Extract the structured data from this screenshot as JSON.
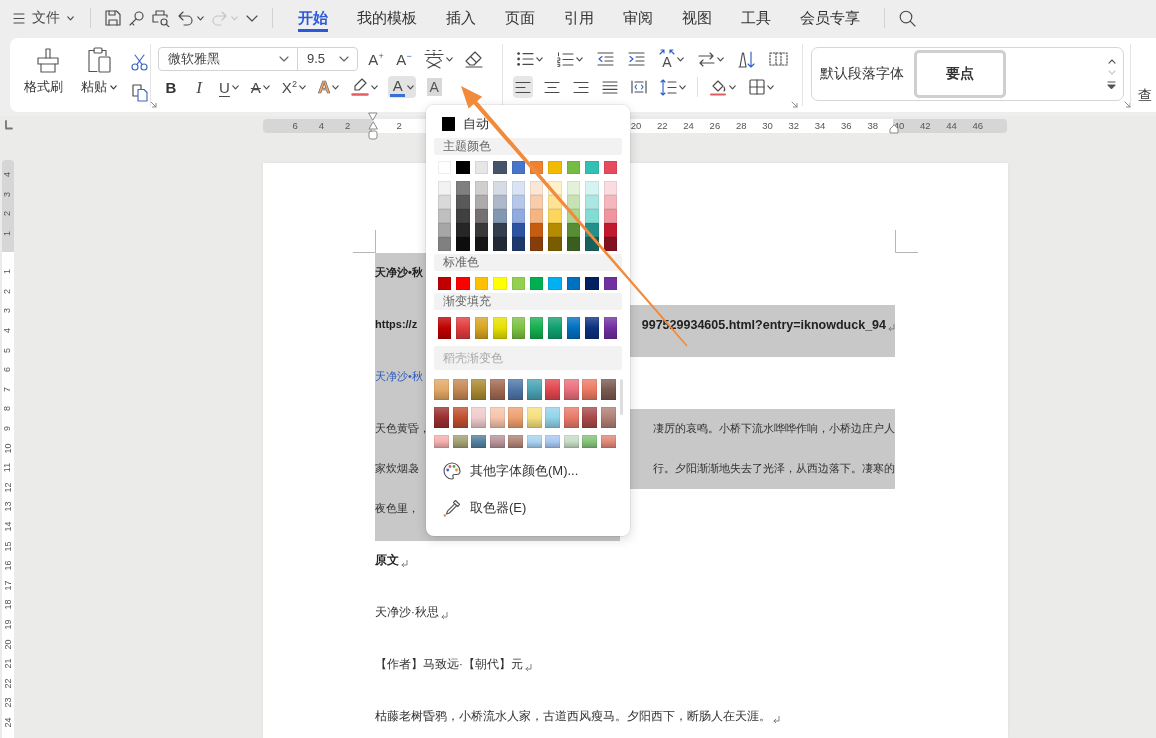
{
  "menu_bar": {
    "file_menu": {
      "label": "文件"
    },
    "quick_access": [
      {
        "kind": "save",
        "dropdown": false,
        "disabled": false
      },
      {
        "kind": "key",
        "dropdown": false,
        "disabled": false
      },
      {
        "kind": "print_preview",
        "dropdown": false,
        "disabled": false
      },
      {
        "kind": "undo",
        "dropdown": true,
        "disabled": false
      },
      {
        "kind": "redo",
        "dropdown": true,
        "disabled": true
      },
      {
        "kind": "customize",
        "dropdown": false,
        "disabled": false
      }
    ],
    "tabs": [
      {
        "label": "开始",
        "selected": true
      },
      {
        "label": "我的模板",
        "selected": false
      },
      {
        "label": "插入",
        "selected": false
      },
      {
        "label": "页面",
        "selected": false
      },
      {
        "label": "引用",
        "selected": false
      },
      {
        "label": "审阅",
        "selected": false
      },
      {
        "label": "视图",
        "selected": false
      },
      {
        "label": "工具",
        "selected": false
      },
      {
        "label": "会员专享",
        "selected": false
      }
    ]
  },
  "ribbon": {
    "clipboard": {
      "launcher": true,
      "large_buttons": [
        {
          "kind": "format_painter",
          "label": "格式刷",
          "dropdown": false
        },
        {
          "kind": "paste",
          "label": "粘贴",
          "dropdown": true
        }
      ],
      "small_buttons": [
        {
          "kind": "cut"
        },
        {
          "kind": "copy"
        }
      ]
    },
    "font": {
      "font_name": "微软雅黑",
      "font_size": "9.5",
      "row1": [
        {
          "kind": "grow_font",
          "label": "A$^{+}$",
          "dropdown": false
        },
        {
          "kind": "shrink_font",
          "label": "A$^{−}$",
          "dropdown": false
        },
        {
          "kind": "phonetic_guide",
          "dropdown": true
        },
        {
          "kind": "clear_formatting",
          "dropdown": false
        }
      ],
      "row2": [
        {
          "kind": "bold",
          "label": "B",
          "dropdown": false,
          "active": false
        },
        {
          "kind": "italic",
          "label": "I",
          "dropdown": false,
          "active": false
        },
        {
          "kind": "underline",
          "label": "U",
          "dropdown": true,
          "active": false
        },
        {
          "kind": "strikethrough",
          "label": "A",
          "dropdown": true,
          "active": false
        },
        {
          "kind": "superscript",
          "label": "X$^{2}$",
          "dropdown": true,
          "active": false
        },
        {
          "kind": "text_effects",
          "label": "A",
          "dropdown": true,
          "active": false
        },
        {
          "kind": "highlight",
          "dropdown": true,
          "active": false
        },
        {
          "kind": "font_color",
          "label": "A",
          "dropdown": true,
          "active": true,
          "color": "#3a6fd8"
        },
        {
          "kind": "character_shading",
          "label": "A",
          "dropdown": false,
          "active": false
        }
      ]
    },
    "paragraph": {
      "launcher": true,
      "row1": [
        {
          "kind": "bullets",
          "dropdown": true
        },
        {
          "kind": "numbering",
          "dropdown": true
        },
        {
          "kind": "decrease_indent",
          "dropdown": false
        },
        {
          "kind": "increase_indent",
          "dropdown": false
        },
        {
          "kind": "text_direction",
          "label": "A",
          "dropdown": true
        },
        {
          "kind": "swap",
          "dropdown": true
        },
        {
          "kind": "sort",
          "dropdown": false
        },
        {
          "kind": "show_marks",
          "dropdown": false
        }
      ],
      "row2": [
        {
          "kind": "align_left",
          "dropdown": false,
          "selected": true
        },
        {
          "kind": "align_center",
          "dropdown": false,
          "selected": false
        },
        {
          "kind": "align_right",
          "dropdown": false,
          "selected": false
        },
        {
          "kind": "justify",
          "dropdown": false,
          "selected": false
        },
        {
          "kind": "distribute",
          "dropdown": false,
          "selected": false
        },
        {
          "kind": "line_spacing",
          "dropdown": true,
          "selected": false
        },
        {
          "kind": "shading",
          "dropdown": true,
          "selected": false
        },
        {
          "kind": "borders",
          "dropdown": true,
          "selected": false
        }
      ]
    },
    "styles": {
      "launcher": true,
      "items": [
        {
          "label": "默认段落字体",
          "kind": "plain",
          "selected": false
        },
        {
          "label": "要点",
          "kind": "bold",
          "selected": true
        }
      ],
      "scroll_buttons": [
        {
          "kind": "up",
          "disabled": false
        },
        {
          "kind": "down",
          "disabled": true
        },
        {
          "kind": "more",
          "disabled": false
        }
      ]
    },
    "next_group_label": "查"
  },
  "rulers": {
    "horizontal": {
      "left_labels": [
        "6",
        "4",
        "2"
      ],
      "inner_labels": [
        "2"
      ],
      "right_labels": [
        "20",
        "22",
        "24",
        "26",
        "28",
        "30",
        "32",
        "34",
        "36",
        "38",
        "40",
        "42",
        "44",
        "46"
      ]
    },
    "vertical": {
      "top_labels": [
        "4",
        "3",
        "2",
        "1"
      ],
      "page_labels": [
        "1",
        "2",
        "3",
        "4",
        "5",
        "6",
        "7",
        "8",
        "9",
        "10",
        "11",
        "12",
        "13",
        "14",
        "15",
        "16",
        "17",
        "18",
        "19",
        "20",
        "21",
        "22",
        "23",
        "24"
      ]
    }
  },
  "font_color_menu": {
    "automatic": {
      "label": "自动",
      "color": "#000000"
    },
    "sections": [
      {
        "title": "主题颜色",
        "kind": "theme",
        "dimmed": false,
        "rows": [
          [
            {
              "color": "#ffffff"
            },
            {
              "color": "#000000"
            },
            {
              "color": "#e7e6e6"
            },
            {
              "color": "#44546a"
            },
            {
              "color": "#4874cb"
            },
            {
              "color": "#ee822f"
            },
            {
              "color": "#f2ba02"
            },
            {
              "color": "#75bd42"
            },
            {
              "color": "#30c0b4"
            },
            {
              "color": "#e54c5e"
            }
          ],
          [
            {
              "color": "#f2f2f2"
            },
            {
              "color": "#7f7f7f"
            },
            {
              "color": "#d0cece"
            },
            {
              "color": "#d6dce4"
            },
            {
              "color": "#dae3f3"
            },
            {
              "color": "#fce6d5"
            },
            {
              "color": "#fef1c9"
            },
            {
              "color": "#e3f1d9"
            },
            {
              "color": "#d5f3f0"
            },
            {
              "color": "#fadbdf"
            }
          ],
          [
            {
              "color": "#d9d9d9"
            },
            {
              "color": "#595959"
            },
            {
              "color": "#aeabab"
            },
            {
              "color": "#adb9ca"
            },
            {
              "color": "#b6c7ea"
            },
            {
              "color": "#f8cdac"
            },
            {
              "color": "#fde393"
            },
            {
              "color": "#c8e3b3"
            },
            {
              "color": "#abe7e2"
            },
            {
              "color": "#f5b7be"
            }
          ],
          [
            {
              "color": "#bfbfbf"
            },
            {
              "color": "#404040"
            },
            {
              "color": "#757171"
            },
            {
              "color": "#8497b0"
            },
            {
              "color": "#91abe0"
            },
            {
              "color": "#f5b482"
            },
            {
              "color": "#fcd55d"
            },
            {
              "color": "#acd68e"
            },
            {
              "color": "#82dcd4"
            },
            {
              "color": "#f0949e"
            }
          ],
          [
            {
              "color": "#a6a6a6"
            },
            {
              "color": "#262626"
            },
            {
              "color": "#3a3838"
            },
            {
              "color": "#333f4f"
            },
            {
              "color": "#2e54a1"
            },
            {
              "color": "#c65c10"
            },
            {
              "color": "#b58b01"
            },
            {
              "color": "#588e31"
            },
            {
              "color": "#24908b"
            },
            {
              "color": "#c11a2e"
            }
          ],
          [
            {
              "color": "#808080"
            },
            {
              "color": "#0d0d0d"
            },
            {
              "color": "#171616"
            },
            {
              "color": "#222a35"
            },
            {
              "color": "#1f386b"
            },
            {
              "color": "#843d0b"
            },
            {
              "color": "#795c01"
            },
            {
              "color": "#3a5e21"
            },
            {
              "color": "#18605a"
            },
            {
              "color": "#81111e"
            }
          ]
        ]
      },
      {
        "title": "标准色",
        "kind": "solid",
        "dimmed": false,
        "rows": [
          [
            {
              "color": "#c00000"
            },
            {
              "color": "#ff0000"
            },
            {
              "color": "#ffc000"
            },
            {
              "color": "#ffff00"
            },
            {
              "color": "#92d050"
            },
            {
              "color": "#00b050"
            },
            {
              "color": "#00b0f0"
            },
            {
              "color": "#0070c0"
            },
            {
              "color": "#002060"
            },
            {
              "color": "#7030a0"
            }
          ]
        ]
      },
      {
        "title": "渐变填充",
        "kind": "gradient",
        "dimmed": false,
        "rows": [
          [
            {
              "color": "#c00000"
            },
            {
              "color": "#e03c3c"
            },
            {
              "color": "#d9a520"
            },
            {
              "color": "#e6e000"
            },
            {
              "color": "#7cc242"
            },
            {
              "color": "#14b050"
            },
            {
              "color": "#0fa070"
            },
            {
              "color": "#0070c0"
            },
            {
              "color": "#0b2f80"
            },
            {
              "color": "#7030a0"
            }
          ]
        ]
      },
      {
        "title": "稻壳渐变色",
        "kind": "gradient_scroll",
        "dimmed": true,
        "rows": [
          [
            {
              "color": "#e3a866"
            },
            {
              "color": "#c58855"
            },
            {
              "color": "#a88a32"
            },
            {
              "color": "#a06a52"
            },
            {
              "color": "#4f76a8"
            },
            {
              "color": "#4aa3b3"
            },
            {
              "color": "#e2464f"
            },
            {
              "color": "#e8707b"
            },
            {
              "color": "#ec7a63"
            },
            {
              "color": "#7a5a50"
            }
          ],
          [
            {
              "color": "#9b3030"
            },
            {
              "color": "#c0502f"
            },
            {
              "color": "#f0cccc"
            },
            {
              "color": "#f6c4aa"
            },
            {
              "color": "#eea070"
            },
            {
              "color": "#f5e07e"
            },
            {
              "color": "#92d3ea"
            },
            {
              "color": "#e87a68"
            },
            {
              "color": "#a84a4a"
            },
            {
              "color": "#b08075"
            }
          ],
          [
            {
              "color": "#f6b0b0"
            },
            {
              "color": "#a4a275"
            },
            {
              "color": "#55819f"
            },
            {
              "color": "#b9949a"
            },
            {
              "color": "#b08576"
            },
            {
              "color": "#a8d4f0"
            },
            {
              "color": "#a9c9f3"
            },
            {
              "color": "#c8ddc8"
            },
            {
              "color": "#86c47a"
            },
            {
              "color": "#e08a7a"
            }
          ]
        ]
      }
    ],
    "actions": [
      {
        "kind": "more_colors",
        "label": "其他字体颜色(M)..."
      },
      {
        "kind": "eyedropper",
        "label": "取色器(E)"
      }
    ]
  },
  "document": {
    "paragraphs": [
      {
        "kind": "bold",
        "selected": true,
        "paragraph_mark": false,
        "lines": [
          {
            "kind": "covered",
            "left": "天净沙•秋"
          }
        ]
      },
      {
        "kind": "bold",
        "selected": true,
        "paragraph_mark": true,
        "lines": [
          {
            "kind": "covered",
            "left": "https://z",
            "right": "997529934605.html?entry=iknowduck_94"
          }
        ]
      },
      {
        "kind": "accent",
        "selected": true,
        "paragraph_mark": false,
        "lines": [
          {
            "kind": "covered",
            "left": "天净沙•秋"
          }
        ]
      },
      {
        "kind": "plain",
        "selected": true,
        "paragraph_mark": false,
        "lines": [
          {
            "kind": "covered",
            "left": "天色黄昏，",
            "right": "凄厉的哀鸣。小桥下流水哗哗作响，小桥边庄户人"
          },
          {
            "kind": "covered",
            "left": "家炊烟袅",
            "right": "行。夕阳渐渐地失去了光泽，从西边落下。凄寒的"
          },
          {
            "kind": "covered",
            "left": "夜色里，"
          }
        ]
      },
      {
        "kind": "bold",
        "selected": false,
        "paragraph_mark": true,
        "lines": [
          {
            "kind": "full",
            "text": "原文"
          }
        ]
      },
      {
        "kind": "plain",
        "selected": false,
        "paragraph_mark": true,
        "lines": [
          {
            "kind": "full",
            "text": "天净沙·秋思"
          }
        ]
      },
      {
        "kind": "plain",
        "selected": false,
        "paragraph_mark": true,
        "lines": [
          {
            "kind": "full",
            "text": "【作者】马致远·【朝代】元"
          }
        ]
      },
      {
        "kind": "plain",
        "selected": false,
        "paragraph_mark": true,
        "lines": [
          {
            "kind": "full",
            "text": "枯藤老树昏鸦，小桥流水人家，古道西风瘦马。夕阳西下，断肠人在天涯。"
          }
        ]
      }
    ]
  }
}
